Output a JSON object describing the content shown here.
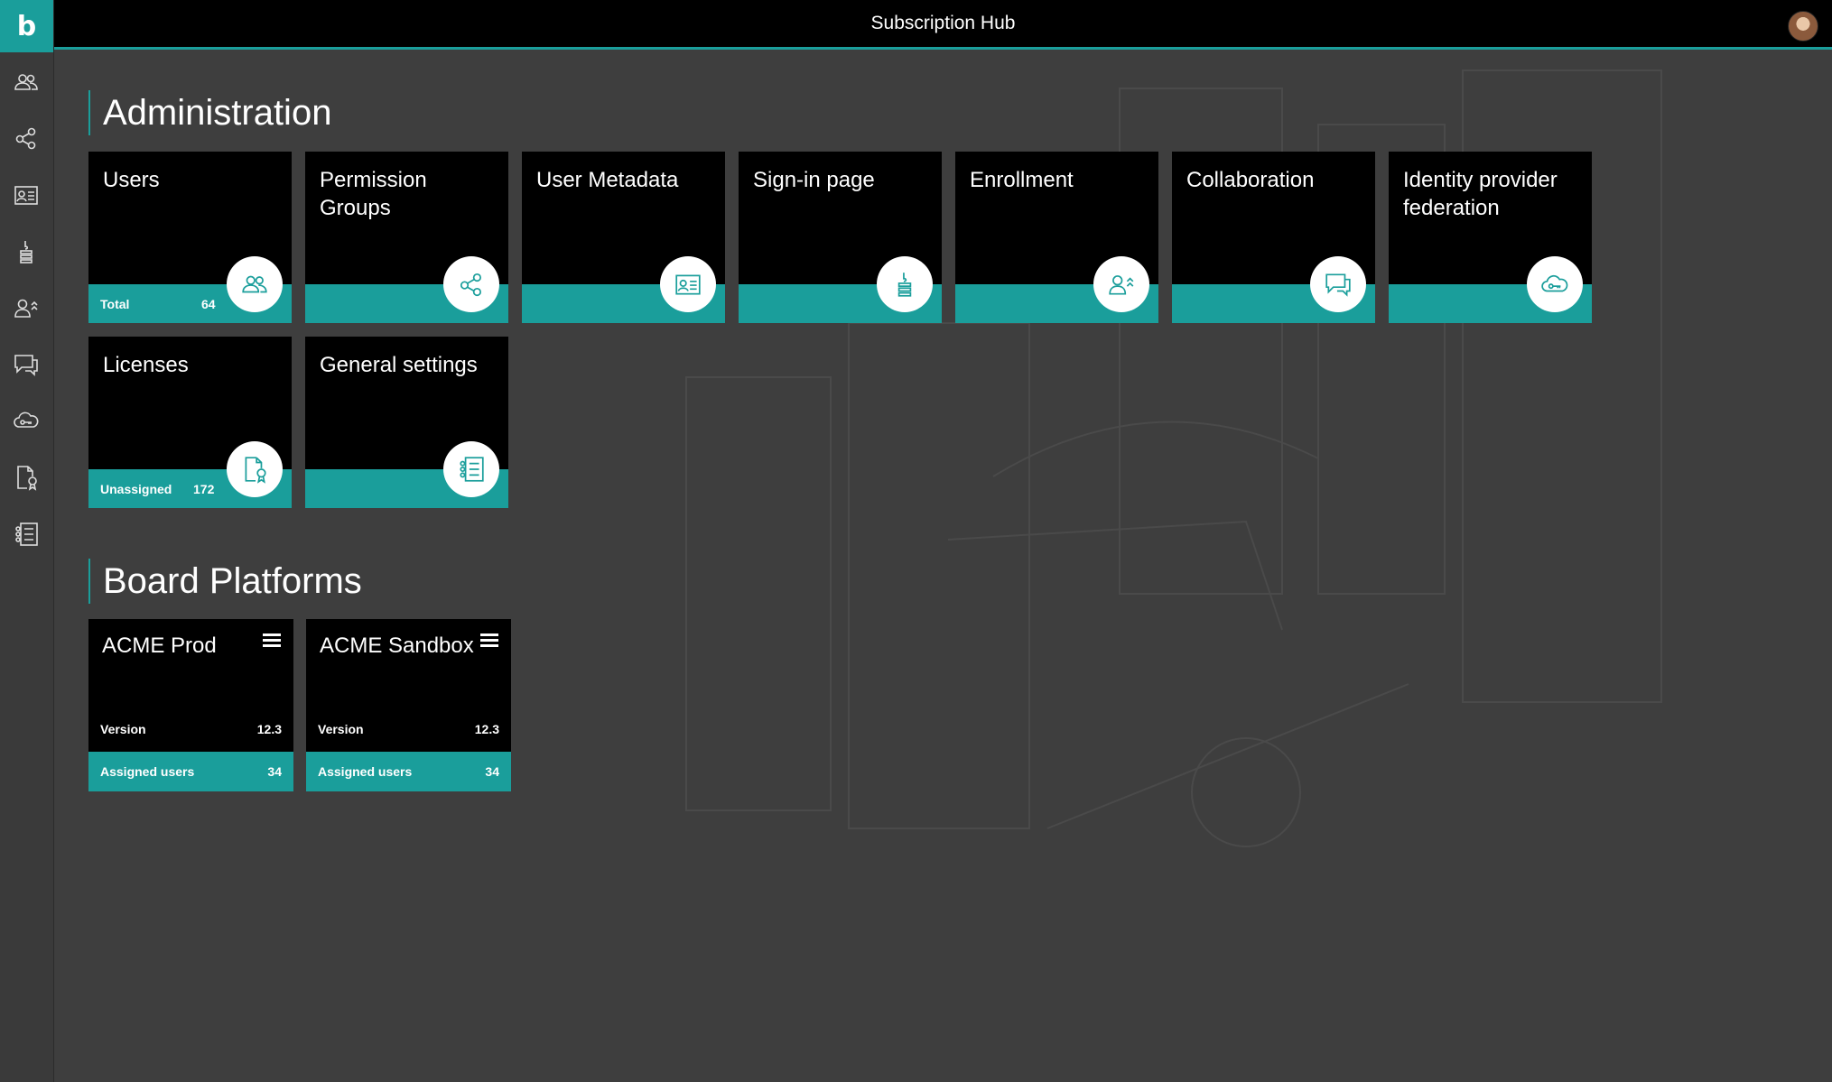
{
  "app": {
    "logo_letter": "b",
    "title": "Subscription Hub"
  },
  "colors": {
    "accent": "#1a9e9b",
    "tile_bg": "#000000",
    "page_bg": "#3e3e3e"
  },
  "sidebar": {
    "items": [
      {
        "icon": "users-icon"
      },
      {
        "icon": "share-nodes-icon"
      },
      {
        "icon": "id-card-icon"
      },
      {
        "icon": "sign-in-icon"
      },
      {
        "icon": "user-enroll-icon"
      },
      {
        "icon": "chat-icon"
      },
      {
        "icon": "cloud-key-icon"
      },
      {
        "icon": "license-icon"
      },
      {
        "icon": "settings-list-icon"
      }
    ]
  },
  "administration": {
    "heading": "Administration",
    "tiles": [
      {
        "title": "Users",
        "icon": "users-icon",
        "footer_label": "Total",
        "footer_value": "64"
      },
      {
        "title": "Permission Groups",
        "icon": "share-nodes-icon"
      },
      {
        "title": "User Metadata",
        "icon": "id-card-icon"
      },
      {
        "title": "Sign-in page",
        "icon": "sign-in-icon"
      },
      {
        "title": "Enrollment",
        "icon": "user-enroll-icon"
      },
      {
        "title": "Collaboration",
        "icon": "chat-icon"
      },
      {
        "title": "Identity provider federation",
        "icon": "cloud-key-icon"
      },
      {
        "title": "Licenses",
        "icon": "license-icon",
        "footer_label": "Unassigned",
        "footer_value": "172"
      },
      {
        "title": "General settings",
        "icon": "settings-list-icon"
      }
    ]
  },
  "board_platforms": {
    "heading": "Board Platforms",
    "cards": [
      {
        "title": "ACME Prod",
        "version_label": "Version",
        "version": "12.3",
        "users_label": "Assigned users",
        "users": "34"
      },
      {
        "title": "ACME Sandbox",
        "version_label": "Version",
        "version": "12.3",
        "users_label": "Assigned users",
        "users": "34"
      }
    ]
  }
}
